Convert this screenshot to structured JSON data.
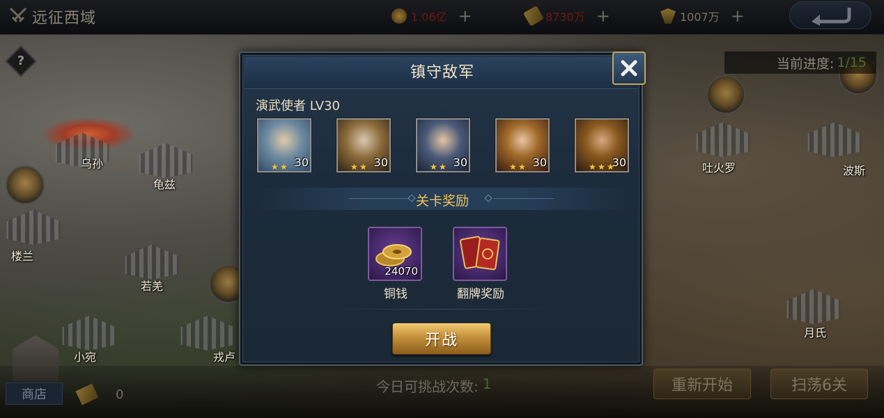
{
  "topbar": {
    "stage_title": "远征西域",
    "resources": [
      {
        "name": "copper",
        "icon": "copper-coin-icon",
        "value": "1.06亿",
        "color": "#6a1b14"
      },
      {
        "name": "food",
        "icon": "feather-icon",
        "value": "8730万",
        "color": "#6a1b14"
      },
      {
        "name": "honor",
        "icon": "wings-icon",
        "value": "1007万",
        "color": "#7b7366"
      }
    ]
  },
  "map": {
    "cities": [
      "乌孙",
      "龟兹",
      "楼兰",
      "若羌",
      "小宛",
      "戎卢",
      "吐火罗",
      "波斯",
      "月氏"
    ],
    "progress_label": "当前进度:",
    "progress_value": "1/15"
  },
  "bottombar": {
    "shop_label": "商店",
    "ticket_count": "0",
    "challenge_label": "今日可挑战次数:",
    "challenge_count": "1",
    "restart_label": "重新开始",
    "sweep_label": "扫荡6关"
  },
  "dialog": {
    "title": "镇守敌军",
    "enemy_name": "演武使者  LV30",
    "heroes": [
      {
        "level": "30",
        "stars": 2
      },
      {
        "level": "30",
        "stars": 2
      },
      {
        "level": "30",
        "stars": 2
      },
      {
        "level": "30",
        "stars": 2
      },
      {
        "level": "30",
        "stars": 3
      }
    ],
    "reward_title": "关卡奖励",
    "rewards": [
      {
        "name": "铜钱",
        "amount": "24070"
      },
      {
        "name": "翻牌奖励",
        "amount": ""
      }
    ],
    "start_label": "开战"
  },
  "colors": {
    "accent_gold": "#f0c451",
    "panel_bg": "#1d2c3c",
    "reward_purple": "#6a3f93"
  }
}
